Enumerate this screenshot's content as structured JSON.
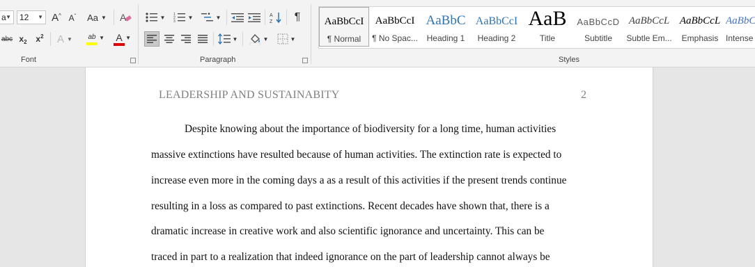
{
  "ribbon": {
    "font": {
      "font_name": "a",
      "font_size": "12",
      "grow_font_icon": "grow-font-icon",
      "shrink_font_icon": "shrink-font-icon",
      "change_case_label": "Aa",
      "clear_formatting_icon": "clear-formatting-icon",
      "strikethrough_label": "abc",
      "subscript_label": "x",
      "subscript_mark": "2",
      "superscript_label": "x",
      "superscript_mark": "2",
      "text_effects_label": "A",
      "highlight_label": "ab",
      "highlight_color": "#ffff00",
      "font_color_label": "A",
      "font_color": "#e00000",
      "group_label": "Font"
    },
    "paragraph": {
      "bullets_icon": "bullets-icon",
      "numbering_icon": "numbering-icon",
      "multilevel_icon": "multilevel-list-icon",
      "decrease_indent_icon": "decrease-indent-icon",
      "increase_indent_icon": "increase-indent-icon",
      "sort_icon": "sort-icon",
      "show_marks_label": "¶",
      "align_left_icon": "align-left-icon",
      "center_icon": "align-center-icon",
      "align_right_icon": "align-right-icon",
      "justify_icon": "justify-icon",
      "line_spacing_icon": "line-spacing-icon",
      "shading_icon": "shading-icon",
      "borders_icon": "borders-icon",
      "group_label": "Paragraph"
    },
    "styles": {
      "group_label": "Styles",
      "items": [
        {
          "preview": "AaBbCcI",
          "name": "¶ Normal",
          "color": "#000000"
        },
        {
          "preview": "AaBbCcI",
          "name": "¶ No Spac...",
          "color": "#000000"
        },
        {
          "preview": "AaBbC",
          "name": "Heading 1",
          "color": "#2e74b5"
        },
        {
          "preview": "AaBbCcI",
          "name": "Heading 2",
          "color": "#2e74b5"
        },
        {
          "preview": "AaB",
          "name": "Title",
          "color": "#000000"
        },
        {
          "preview": "AaBbCcD",
          "name": "Subtitle",
          "color": "#5a5a5a"
        },
        {
          "preview": "AaBbCcL",
          "name": "Subtle Em...",
          "color": "#404040"
        },
        {
          "preview": "AaBbCcL",
          "name": "Emphasis",
          "color": "#000000"
        },
        {
          "preview": "AaBbCcL",
          "name": "Intense E",
          "color": "#4472c4"
        }
      ]
    }
  },
  "document": {
    "header_title": "LEADERSHIP AND SUSTAINABITY",
    "page_number": "2",
    "lines": [
      "Despite knowing about the importance of biodiversity for a long time, human activities",
      "massive extinctions have resulted because of human activities. The extinction rate is expected to",
      "increase even more in the coming days a as a result of this activities if the present trends continue",
      "resulting in a loss as compared to past extinctions. Recent decades have shown that, there is a",
      "dramatic increase in creative work and also scientific ignorance and uncertainty. This can be",
      "traced in part to a realization that indeed ignorance on the part of leadership cannot always be"
    ]
  }
}
